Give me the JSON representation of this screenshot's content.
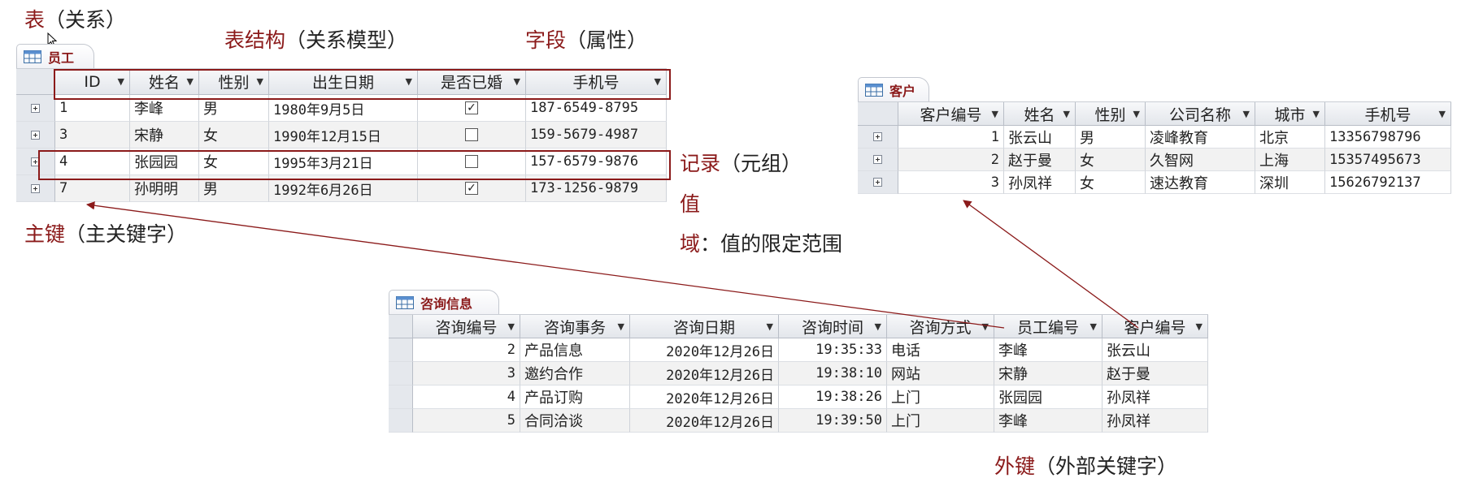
{
  "annotations": {
    "table": {
      "kw": "表",
      "rest": "（关系）"
    },
    "structure": {
      "kw": "表结构",
      "rest": "（关系模型）"
    },
    "field": {
      "kw": "字段",
      "rest": "（属性）"
    },
    "record": {
      "kw": "记录",
      "rest": "（元组）"
    },
    "value": {
      "kw": "值",
      "rest": ""
    },
    "domain": {
      "kw": "域",
      "rest": "：值的限定范围"
    },
    "primary_key": {
      "kw": "主键",
      "rest": "（主关键字）"
    },
    "foreign_key": {
      "kw": "外键",
      "rest": "（外部关键字）"
    }
  },
  "colors": {
    "accent": "#8b1a1a",
    "header_bg": "#e8ebef",
    "alt_row": "#f2f2f2"
  },
  "employee": {
    "tab": "员工",
    "icon": "table-icon",
    "headers": [
      "ID",
      "姓名",
      "性别",
      "出生日期",
      "是否已婚",
      "手机号"
    ],
    "rows": [
      {
        "id": "1",
        "name": "李峰",
        "gender": "男",
        "birth": "1980年9月5日",
        "married": true,
        "phone": "187-6549-8795"
      },
      {
        "id": "3",
        "name": "宋静",
        "gender": "女",
        "birth": "1990年12月15日",
        "married": false,
        "phone": "159-5679-4987"
      },
      {
        "id": "4",
        "name": "张园园",
        "gender": "女",
        "birth": "1995年3月21日",
        "married": false,
        "phone": "157-6579-9876"
      },
      {
        "id": "7",
        "name": "孙明明",
        "gender": "男",
        "birth": "1992年6月26日",
        "married": true,
        "phone": "173-1256-9879"
      }
    ]
  },
  "customer": {
    "tab": "客户",
    "icon": "table-icon",
    "headers": [
      "客户编号",
      "姓名",
      "性别",
      "公司名称",
      "城市",
      "手机号"
    ],
    "rows": [
      {
        "no": "1",
        "name": "张云山",
        "gender": "男",
        "company": "凌峰教育",
        "city": "北京",
        "phone": "13356798796"
      },
      {
        "no": "2",
        "name": "赵于曼",
        "gender": "女",
        "company": "久智网",
        "city": "上海",
        "phone": "15357495673"
      },
      {
        "no": "3",
        "name": "孙凤祥",
        "gender": "女",
        "company": "速达教育",
        "city": "深圳",
        "phone": "15626792137"
      }
    ]
  },
  "consult": {
    "tab": "咨询信息",
    "icon": "table-icon",
    "headers": [
      "咨询编号",
      "咨询事务",
      "咨询日期",
      "咨询时间",
      "咨询方式",
      "员工编号",
      "客户编号"
    ],
    "rows": [
      {
        "no": "2",
        "matter": "产品信息",
        "date": "2020年12月26日",
        "time": "19:35:33",
        "method": "电话",
        "emp": "李峰",
        "cust": "张云山"
      },
      {
        "no": "3",
        "matter": "邀约合作",
        "date": "2020年12月26日",
        "time": "19:38:10",
        "method": "网站",
        "emp": "宋静",
        "cust": "赵于曼"
      },
      {
        "no": "4",
        "matter": "产品订购",
        "date": "2020年12月26日",
        "time": "19:38:26",
        "method": "上门",
        "emp": "张园园",
        "cust": "孙凤祥"
      },
      {
        "no": "5",
        "matter": "合同洽谈",
        "date": "2020年12月26日",
        "time": "19:39:50",
        "method": "上门",
        "emp": "李峰",
        "cust": "孙凤祥"
      }
    ]
  }
}
